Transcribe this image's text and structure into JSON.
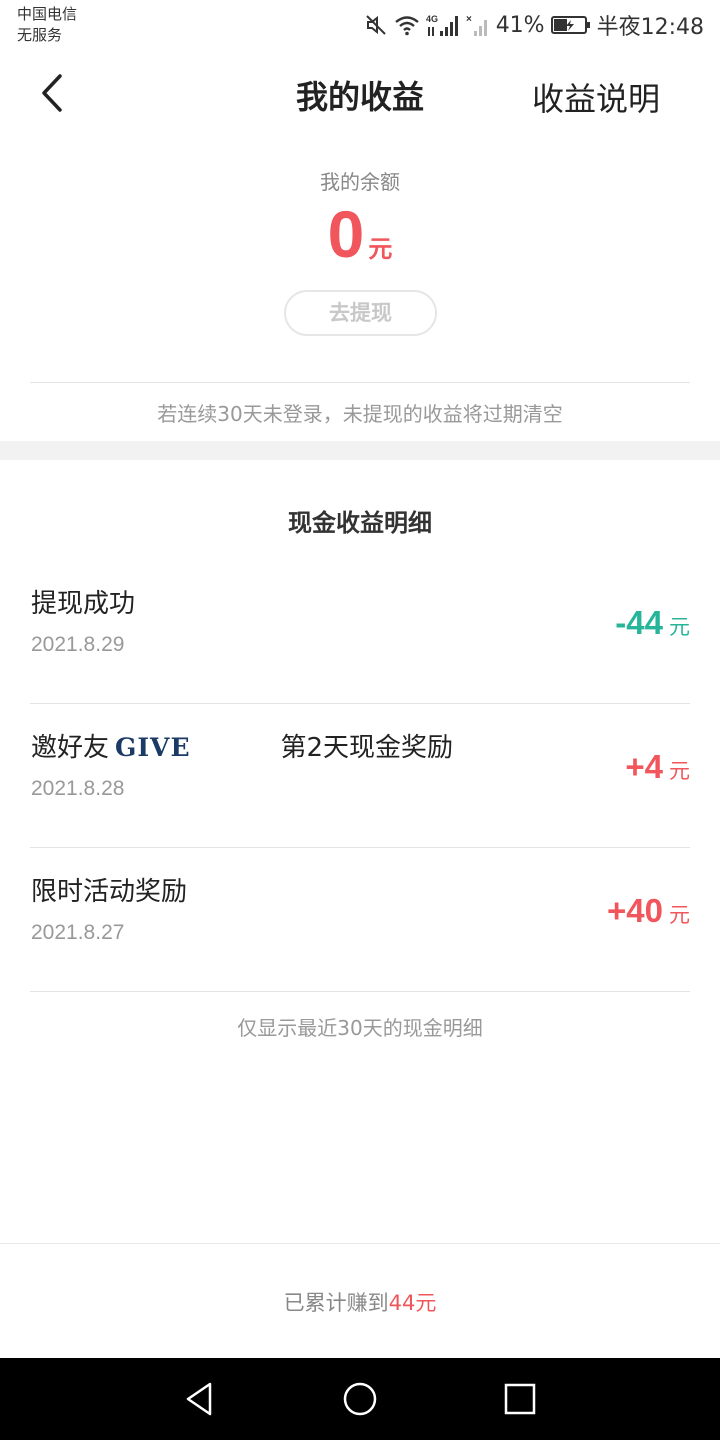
{
  "status_bar": {
    "carrier_line1": "中国电信",
    "carrier_line2": "无服务",
    "network": "4G",
    "battery_percent": "41%",
    "time": "半夜12:48",
    "icons": [
      "mute-icon",
      "wifi-icon",
      "signal-icon",
      "no-signal-icon",
      "battery-icon"
    ]
  },
  "header": {
    "title": "我的收益",
    "right_link": "收益说明"
  },
  "balance": {
    "label": "我的余额",
    "amount": "0",
    "unit": "元",
    "withdraw_button": "去提现",
    "expire_note": "若连续30天未登录，未提现的收益将过期清空"
  },
  "details": {
    "title": "现金收益明细",
    "records": [
      {
        "title": "提现成功",
        "date": "2021.8.29",
        "amount": "-44",
        "unit": "元"
      },
      {
        "title": "邀好友",
        "badge": "GIVE",
        "title_tail": "第2天现金奖励",
        "date": "2021.8.28",
        "amount": "+4",
        "unit": "元"
      },
      {
        "title": "限时活动奖励",
        "date": "2021.8.27",
        "amount": "+40",
        "unit": "元"
      }
    ],
    "note": "仅显示最近30天的现金明细"
  },
  "footer": {
    "total_prefix": "已累计赚到",
    "total_value": "44元"
  },
  "colors": {
    "accent_red": "#f0565b",
    "accent_green": "#27b59a",
    "badge_navy": "#1c3a66"
  }
}
